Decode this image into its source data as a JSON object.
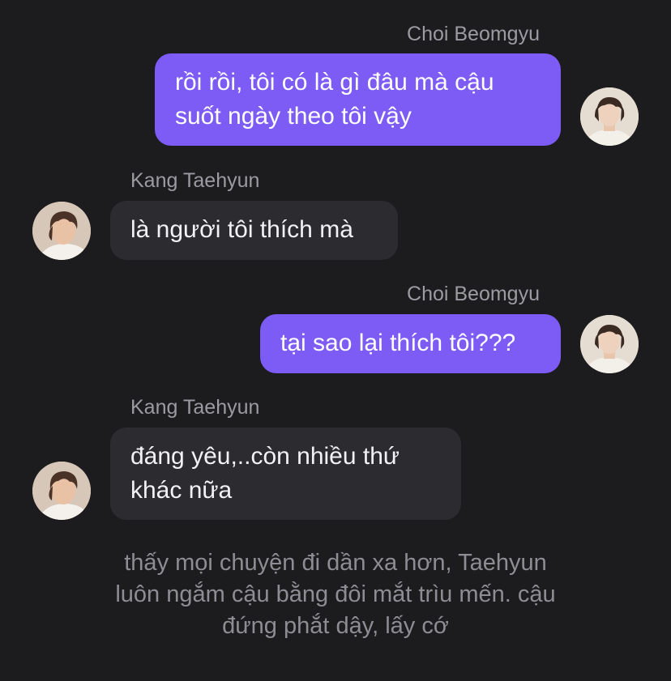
{
  "colors": {
    "background": "#1c1b1e",
    "outgoing_bubble": "#7d5bf5",
    "incoming_bubble": "#2c2b30",
    "sender_name": "#9c9ba1",
    "narration_text": "#8e8d93"
  },
  "messages": [
    {
      "sender": "Choi Beomgyu",
      "direction": "outgoing",
      "lines": [
        "rồi rồi, tôi có là gì đâu mà cậu",
        "suốt ngày theo tôi vậy"
      ]
    },
    {
      "sender": "Kang Taehyun",
      "direction": "incoming",
      "lines": [
        "là người tôi thích mà"
      ]
    },
    {
      "sender": "Choi Beomgyu",
      "direction": "outgoing",
      "lines": [
        "tại sao lại thích tôi???"
      ]
    },
    {
      "sender": "Kang Taehyun",
      "direction": "incoming",
      "lines": [
        "đáng yêu,..còn nhiều thứ",
        "khác nữa"
      ]
    }
  ],
  "avatars": {
    "beomgyu": "avatar-photo-icon",
    "taehyun": "avatar-photo-icon"
  },
  "narration": {
    "lines": [
      "thấy mọi chuyện đi dần xa hơn, Taehyun",
      "luôn ngắm cậu bằng đôi mắt trìu mến. cậu",
      "đứng phắt dậy, lấy cớ"
    ]
  }
}
